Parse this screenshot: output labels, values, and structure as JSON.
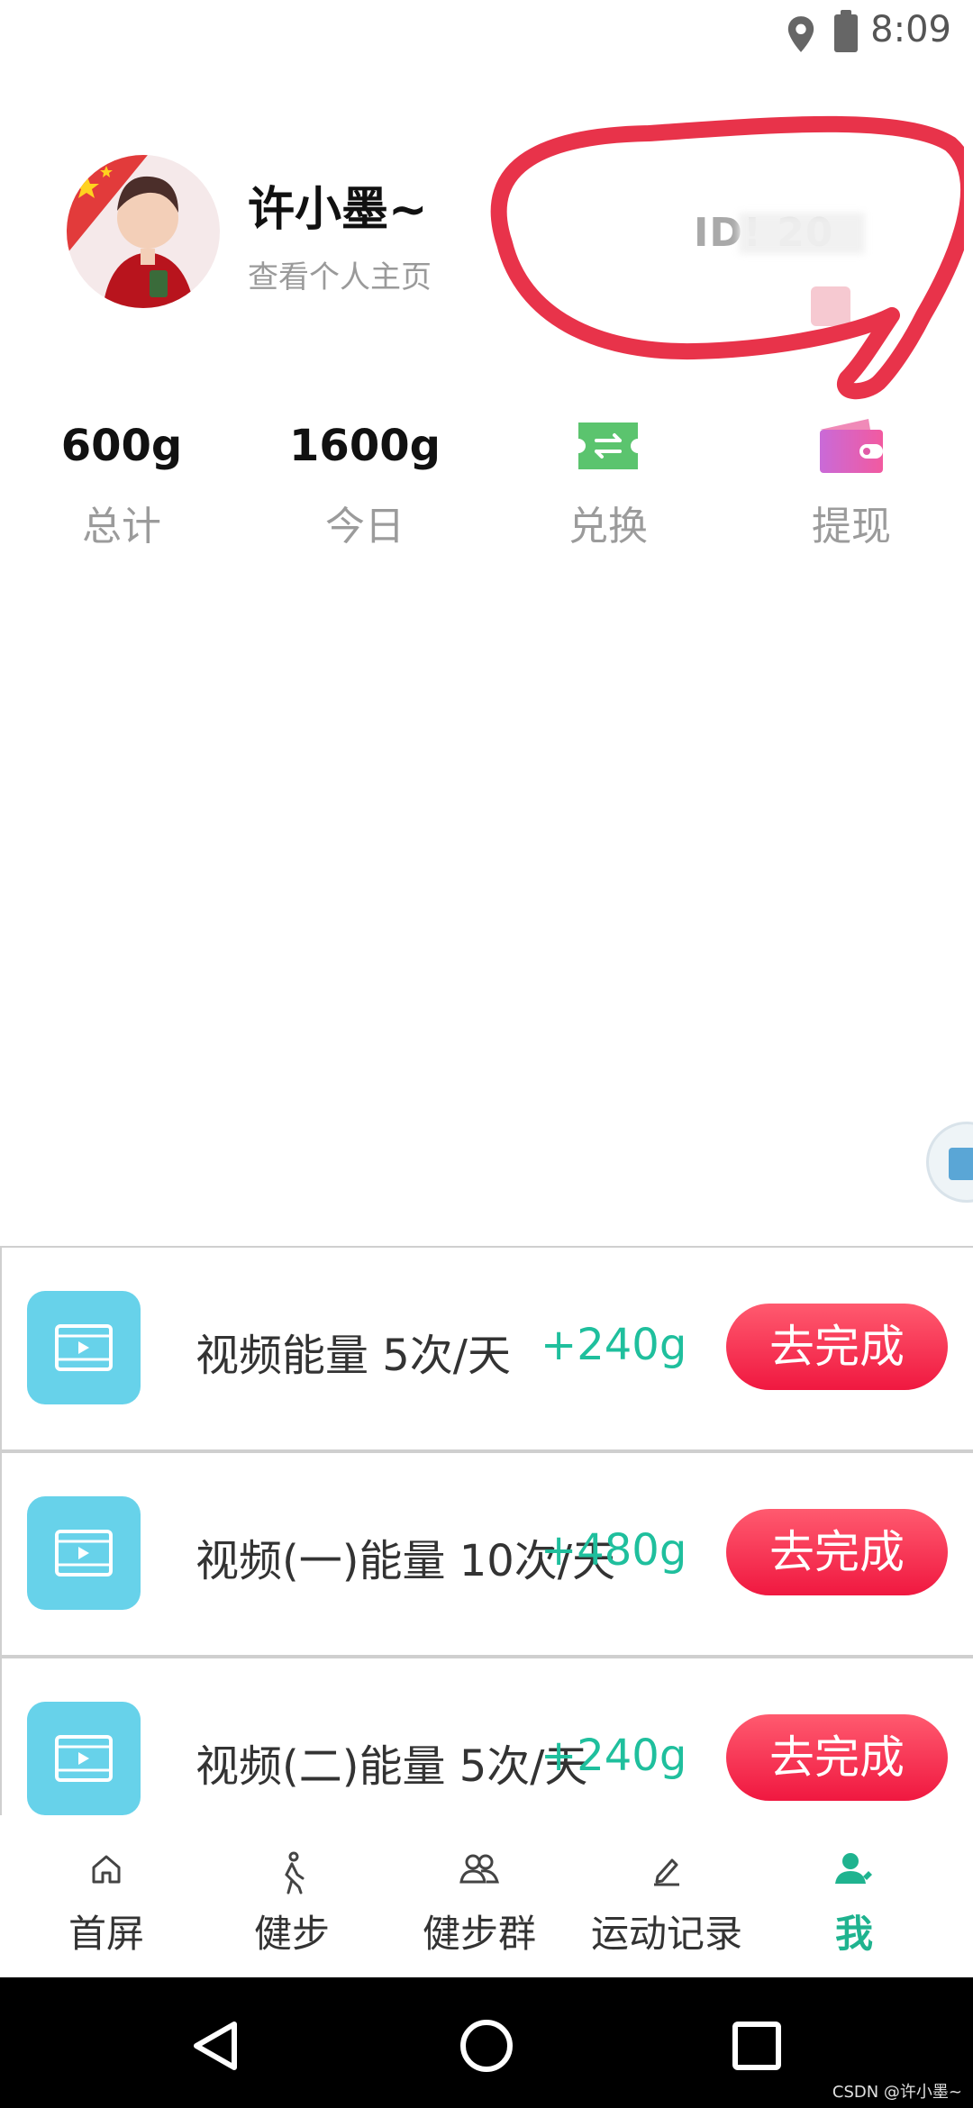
{
  "status": {
    "time": "8:09"
  },
  "profile": {
    "name": "许小墨~",
    "subtitle": "查看个人主页",
    "id_text": "ID!        20"
  },
  "stats": [
    {
      "value": "600g",
      "label": "总计"
    },
    {
      "value": "1600g",
      "label": "今日"
    },
    {
      "label": "兑换",
      "icon": "exchange-icon",
      "color": "#5bc46e"
    },
    {
      "label": "提现",
      "icon": "wallet-icon",
      "color": "#d84fd0"
    }
  ],
  "tasks": [
    {
      "title": "视频能量 5次/天",
      "bonus": "+240g",
      "button": "去完成"
    },
    {
      "title": "视频(一)能量 10次/天",
      "bonus": "+480g",
      "button": "去完成"
    },
    {
      "title": "视频(二)能量 5次/天",
      "bonus": "+240g",
      "button": "去完成"
    }
  ],
  "tabs": [
    {
      "label": "首屏",
      "icon": "home-icon"
    },
    {
      "label": "健步",
      "icon": "walking-icon"
    },
    {
      "label": "健步群",
      "icon": "group-icon"
    },
    {
      "label": "运动记录",
      "icon": "edit-icon"
    },
    {
      "label": "我",
      "icon": "user-icon",
      "active": true
    }
  ],
  "watermark": "CSDN @许小墨~",
  "colors": {
    "accent": "#1fb38f",
    "button": "#f01840",
    "task_icon_bg": "#67d2ea",
    "scribble": "#e8334a"
  }
}
